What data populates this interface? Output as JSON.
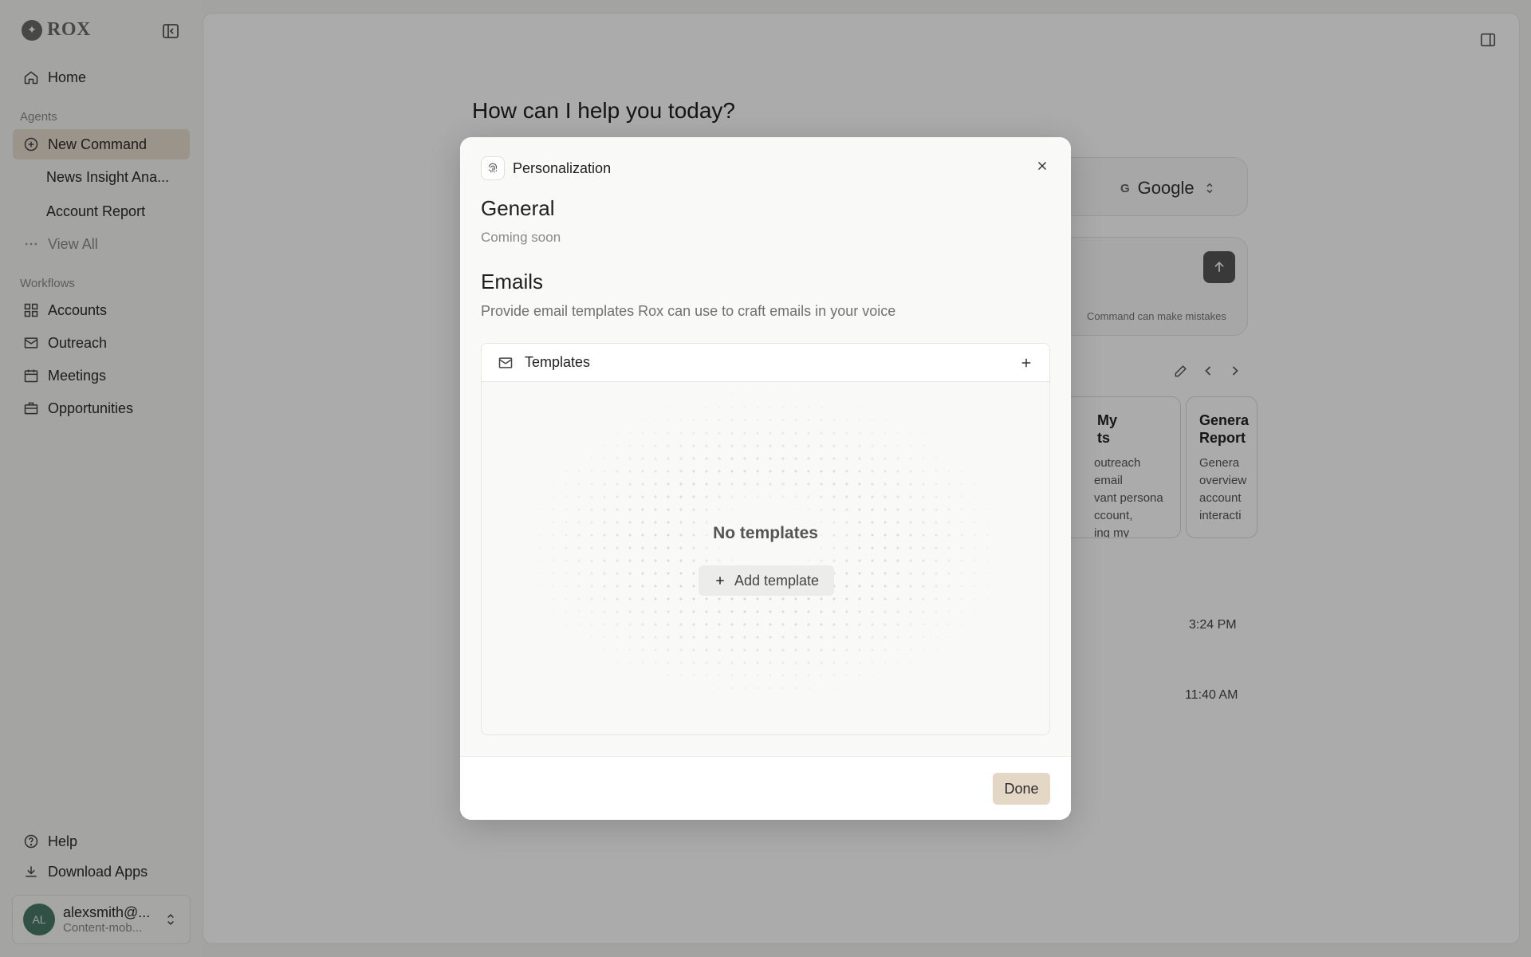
{
  "sidebar": {
    "brand": "ROX",
    "home": "Home",
    "agents_label": "Agents",
    "agents": [
      {
        "label": "New Command"
      },
      {
        "label": "News Insight Ana..."
      },
      {
        "label": "Account Report"
      }
    ],
    "view_all": "View All",
    "workflows_label": "Workflows",
    "workflows": [
      {
        "label": "Accounts"
      },
      {
        "label": "Outreach"
      },
      {
        "label": "Meetings"
      },
      {
        "label": "Opportunities"
      }
    ],
    "help": "Help",
    "download": "Download Apps",
    "user": {
      "initials": "AL",
      "name": "alexsmith@...",
      "sub": "Content-mob..."
    }
  },
  "main": {
    "greeting": "How can I help you today?",
    "model": "Google",
    "model_icon": "G",
    "disclaimer": "Command can make mistakes",
    "cards": [
      {
        "title": "My\nts",
        "desc": "outreach email\nvant persona\nccount,\ning my"
      },
      {
        "title": "Genera\nReport",
        "desc": "Genera\noverview\naccount\ninteracti"
      }
    ],
    "times": [
      "3:24 PM",
      "11:40 AM"
    ]
  },
  "modal": {
    "title": "Personalization",
    "general_heading": "General",
    "general_sub": "Coming soon",
    "emails_heading": "Emails",
    "emails_sub": "Provide email templates Rox can use to craft emails in your voice",
    "templates_label": "Templates",
    "empty_title": "No templates",
    "add_template": "Add template",
    "done": "Done"
  },
  "colors": {
    "active_nav": "#e8ddd0",
    "done_button": "#e5d7c6",
    "overlay": "rgba(0,0,0,0.33)"
  }
}
